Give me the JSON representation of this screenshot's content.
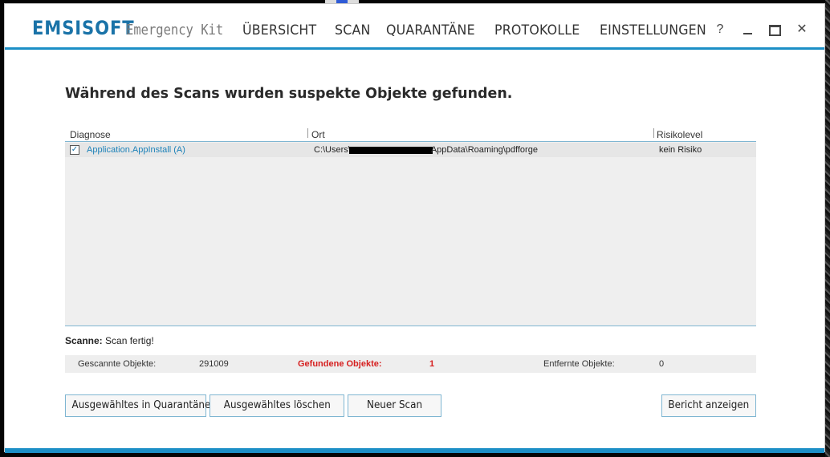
{
  "app": {
    "brand_left": "EMSI",
    "brand_right": "SOFT",
    "subtitle": "Emergency Kit"
  },
  "nav": {
    "items": [
      "ÜBERSICHT",
      "SCAN",
      "QUARANTÄNE",
      "PROTOKOLLE",
      "EINSTELLUNGEN"
    ]
  },
  "window_controls": {
    "help": "?",
    "close": "✕"
  },
  "main": {
    "heading": "Während des Scans wurden suspekte Objekte gefunden."
  },
  "table": {
    "columns": [
      "Diagnose",
      "Ort",
      "Risikolevel"
    ],
    "rows": [
      {
        "checked": true,
        "diagnose": "Application.AppInstall (A)",
        "ort_prefix": "C:\\Users\\",
        "ort_suffix": "AppData\\Roaming\\pdfforge",
        "risiko": "kein Risiko"
      }
    ]
  },
  "status": {
    "label": "Scanne:",
    "value": "Scan fertig!"
  },
  "stats": {
    "scanned_label": "Gescannte Objekte:",
    "scanned_value": "291009",
    "found_label": "Gefundene Objekte:",
    "found_value": "1",
    "removed_label": "Entfernte Objekte:",
    "removed_value": "0"
  },
  "buttons": {
    "quarantine": "Ausgewähltes in Quarantäne",
    "delete": "Ausgewähltes löschen",
    "new_scan": "Neuer Scan",
    "report": "Bericht anzeigen"
  },
  "colors": {
    "accent": "#1c8fc6",
    "brand": "#1a73a8",
    "danger": "#d62020"
  }
}
